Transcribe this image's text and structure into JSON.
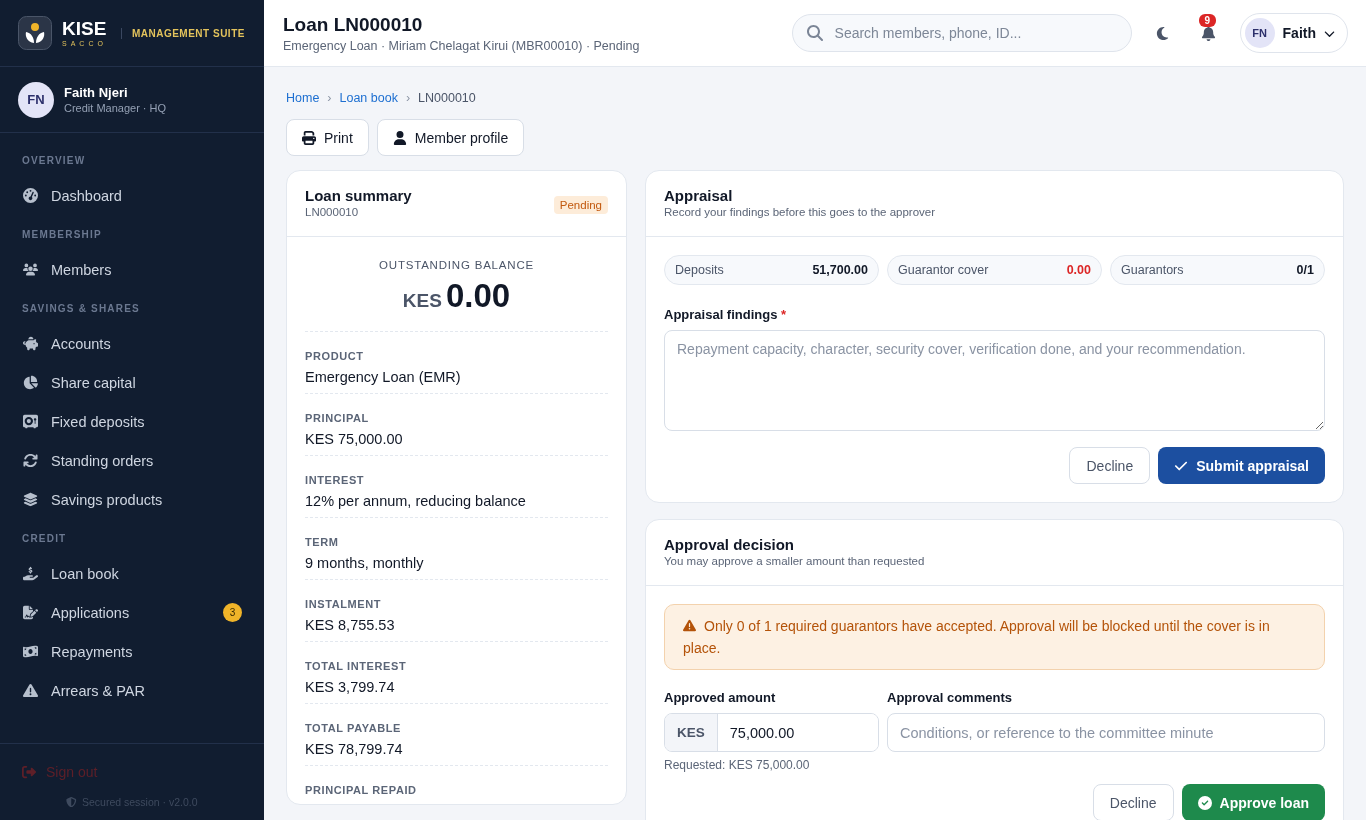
{
  "brand": {
    "name": "KISE",
    "sub": "SACCO",
    "suite": "MANAGEMENT SUITE"
  },
  "user": {
    "initials": "FN",
    "name": "Faith Njeri",
    "role": "Credit Manager · HQ"
  },
  "sidebar": {
    "sections": [
      {
        "title": "OVERVIEW",
        "items": [
          {
            "label": "Dashboard"
          }
        ]
      },
      {
        "title": "MEMBERSHIP",
        "items": [
          {
            "label": "Members"
          }
        ]
      },
      {
        "title": "SAVINGS & SHARES",
        "items": [
          {
            "label": "Accounts"
          },
          {
            "label": "Share capital"
          },
          {
            "label": "Fixed deposits"
          },
          {
            "label": "Standing orders"
          },
          {
            "label": "Savings products"
          }
        ]
      },
      {
        "title": "CREDIT",
        "items": [
          {
            "label": "Loan book"
          },
          {
            "label": "Applications",
            "badge": "3"
          },
          {
            "label": "Repayments"
          },
          {
            "label": "Arrears & PAR"
          }
        ]
      }
    ],
    "sign_out": "Sign out",
    "session": "Secured session · v2.0.0"
  },
  "header": {
    "title": "Loan LN000010",
    "subtitle": "Emergency Loan · Miriam Chelagat Kirui (MBR00010) · Pending",
    "search_placeholder": "Search members, phone, ID...",
    "notifications": "9",
    "user_initials": "FN",
    "user_name": "Faith"
  },
  "breadcrumb": [
    "Home",
    "Loan book",
    "LN000010"
  ],
  "breadcrumb_separator": "›",
  "actions": [
    "Print",
    "Member profile"
  ],
  "summary": {
    "title": "Loan summary",
    "id": "LN000010",
    "status": "Pending",
    "balance_label": "OUTSTANDING BALANCE",
    "currency": "KES",
    "balance": "0.00",
    "fields": [
      {
        "label": "PRODUCT",
        "value": "Emergency Loan (EMR)"
      },
      {
        "label": "PRINCIPAL",
        "value": "KES 75,000.00"
      },
      {
        "label": "INTEREST",
        "value": "12% per annum, reducing balance"
      },
      {
        "label": "TERM",
        "value": "9 months, monthly"
      },
      {
        "label": "INSTALMENT",
        "value": "KES 8,755.53"
      },
      {
        "label": "TOTAL INTEREST",
        "value": "KES 3,799.74"
      },
      {
        "label": "TOTAL PAYABLE",
        "value": "KES 78,799.74"
      },
      {
        "label": "PRINCIPAL REPAID"
      }
    ]
  },
  "appraisal": {
    "title": "Appraisal",
    "subtitle": "Record your findings before this goes to the approver",
    "stats": [
      {
        "label": "Deposits",
        "value": "51,700.00",
        "alert": false
      },
      {
        "label": "Guarantor cover",
        "value": "0.00",
        "alert": true
      },
      {
        "label": "Guarantors",
        "value": "0/1",
        "alert": false
      }
    ],
    "findings_label": "Appraisal findings",
    "required": true,
    "required_mark": "*",
    "findings_placeholder": "Repayment capacity, character, security cover, verification done, and your recommendation.",
    "decline": "Decline",
    "submit": "Submit appraisal"
  },
  "approval": {
    "title": "Approval decision",
    "subtitle": "You may approve a smaller amount than requested",
    "warning": "Only 0 of 1 required guarantors have accepted. Approval will be blocked until the cover is in place.",
    "amount_label": "Approved amount",
    "currency": "KES",
    "amount": "75,000.00",
    "comments_label": "Approval comments",
    "comments_placeholder": "Conditions, or reference to the committee minute",
    "requested": "Requested: KES 75,000.00",
    "decline": "Decline",
    "approve": "Approve loan"
  }
}
